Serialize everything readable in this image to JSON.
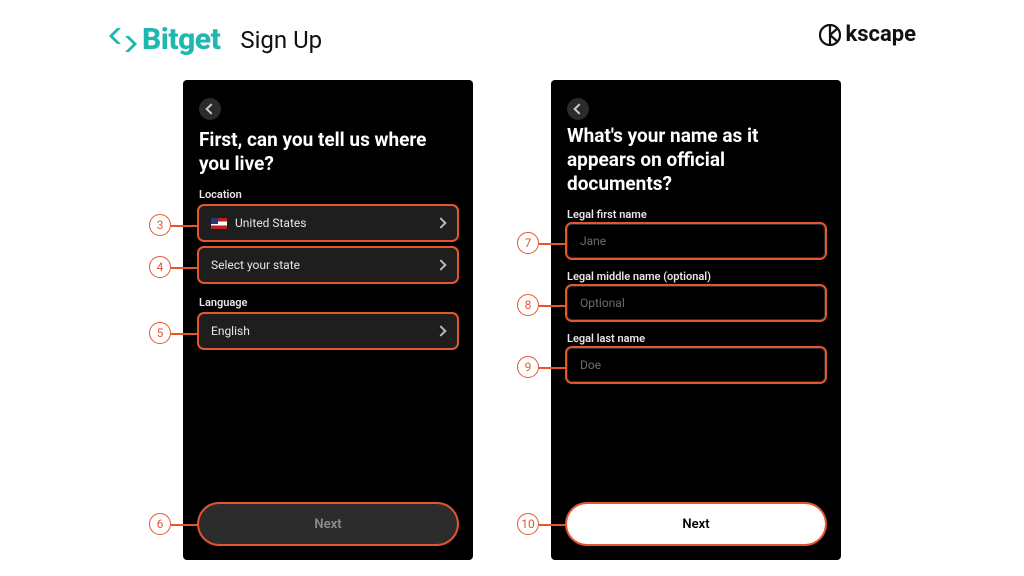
{
  "header": {
    "brand": "Bitget",
    "title": "Sign Up",
    "partner": "kscape"
  },
  "left_screen": {
    "title": "First, can you tell us where you live?",
    "location_label": "Location",
    "country_value": "United States",
    "state_placeholder": "Select your state",
    "language_label": "Language",
    "language_value": "English",
    "next_label": "Next"
  },
  "right_screen": {
    "title": "What's your name as it appears on official documents?",
    "first_label": "Legal first name",
    "first_placeholder": "Jane",
    "middle_label": "Legal middle name (optional)",
    "middle_placeholder": "Optional",
    "last_label": "Legal last name",
    "last_placeholder": "Doe",
    "next_label": "Next"
  },
  "callouts": {
    "c3": "3",
    "c4": "4",
    "c5": "5",
    "c6": "6",
    "c7": "7",
    "c8": "8",
    "c9": "9",
    "c10": "10"
  },
  "colors": {
    "accent": "#1fb8b0",
    "highlight": "#e4572e"
  }
}
